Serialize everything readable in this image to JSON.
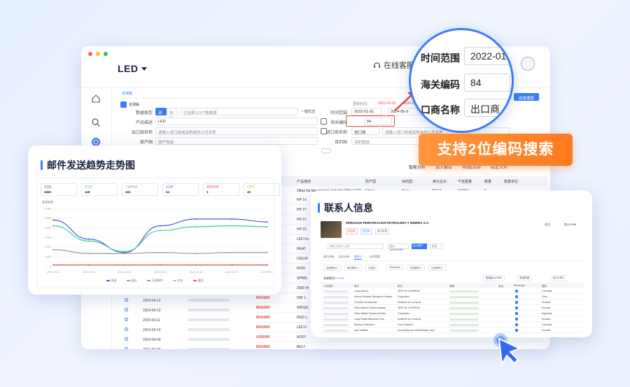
{
  "app": {
    "title": "LED",
    "online_service": "在线客服"
  },
  "window_dots": [
    "#ff5f57",
    "#febc2e",
    "#28c840"
  ],
  "breadcrumb": "全球版",
  "filter": {
    "tag": "全球版",
    "data_type_label": "数据类型",
    "import": "进口",
    "export": "出口",
    "dataset_value": "已选择123个数据源",
    "one_key": "一键优选",
    "product_label": "产品描述",
    "product_value": "LED",
    "exporter_label": "出口商名称",
    "exporter_placeholder": "请输入进口商或采购商的公司名称",
    "origin_label": "原产国",
    "origin_placeholder": "原产地选",
    "update_label": "更新时间：",
    "update_from": "2021-01-01",
    "update_to": "2024-05-09",
    "time_label": "时间范围",
    "time_from": "2022-01-01",
    "time_to": "2024-05-0",
    "hs_label": "海关编码",
    "hs_value": "84",
    "importer_label": "进口商名称",
    "importer_select": "进口商",
    "importer_placeholder": "请输入进口商或采购商的公司名称",
    "dest_label": "目的国",
    "dest_placeholder": "目的国选",
    "advanced_button": "高级搜索"
  },
  "toolbar": {
    "smart_analysis": "智能分析",
    "add_report": "加入报告",
    "export_excel": "导出Excel",
    "custom_columns": "自定义列"
  },
  "table": {
    "headers": [
      "产品描述",
      "原产国",
      "目的国",
      "美元总价",
      "千克重量",
      "数量",
      "数量单位"
    ],
    "first_row": {
      "desc": "Other for the propane industry Other LED",
      "origin": "China",
      "dest": "Peru",
      "price": "$2.67",
      "weight": "3,0064",
      "qty": "6"
    },
    "codes": [
      "4190000",
      "8541800",
      "8541800",
      "8541800",
      "8541800",
      "8541800",
      "4190000",
      "8541800",
      "8541800",
      "8541800",
      "8541800",
      "8541800",
      "8541800",
      "8541800",
      "4190000",
      "8541800",
      "8541800",
      "8541800",
      "8541800",
      "8541800",
      "8541800",
      "8541800",
      "8541800",
      "8541800"
    ],
    "descs": [
      "",
      "HP 14.",
      "HP 27.",
      "HP 21.",
      "HP 21.",
      "LED Fe.",
      "HEAT.",
      "CEILIP.",
      "PF09.",
      "SPWE.",
      "2000 W",
      "DW 1.",
      "WDGN.",
      "RGD L.",
      "LED F.",
      "ASSY.",
      "BELT.",
      "HP 20.",
      "Sight C.",
      "HP 2.",
      "PIXELS.",
      "",
      "",
      ""
    ],
    "bottom_rows": [
      {
        "date": "2024-04-12",
        "code": "8541800",
        "desc": "ASSY."
      },
      {
        "date": "2024-04-12",
        "code": "4190000",
        "desc": "BELT."
      },
      {
        "date": "2024-04-11",
        "code": "8471800",
        "desc": "HP 20."
      },
      {
        "date": "2024-04-10",
        "code": "8471800",
        "desc": "HP 20."
      },
      {
        "date": "2024-04-09",
        "code": "8541800",
        "desc": "Sight C"
      },
      {
        "date": "2024-04-09",
        "code": "8471800",
        "desc": "HP 2."
      },
      {
        "date": "2024-04-06",
        "code": "8471800",
        "desc": "PIXELS."
      }
    ]
  },
  "magnifier": {
    "time_label": "时间范围",
    "time_value": "2022-01-",
    "hs_label": "海关编码",
    "hs_value": "84",
    "exporter_label": "口商名称",
    "exporter_value": "出口商"
  },
  "bubble": "支持2位编码搜索",
  "email_card": {
    "title": "邮件发送趋势走势图",
    "stats": [
      {
        "label": "发送量",
        "value": "4650",
        "color": "#4b5fd6"
      },
      {
        "label": "送达率",
        "value": "448",
        "color": "#3ccf8e"
      },
      {
        "label": "已读邮件数",
        "value": "363",
        "color": "#999999"
      },
      {
        "label": "点击率",
        "value": "64",
        "color": "#4b5fd6"
      },
      {
        "label": "退回邮件数",
        "value": "3",
        "color": "#e05555"
      },
      {
        "label": "回复率",
        "value": "40",
        "color": "#f5b63d"
      }
    ],
    "chart_title": "发送走势",
    "legend": [
      "发送",
      "送达",
      "已读邮件",
      "点击",
      "退回"
    ],
    "legend_colors": [
      "#4b5fd6",
      "#3ccf8e",
      "#999999",
      "#f0a0c0",
      "#e05555"
    ]
  },
  "chart_data": {
    "type": "line",
    "title": "发送走势",
    "x": [
      "2023-02-25",
      "2023-03-24",
      "2023-05-28",
      "2023-05-11",
      "2023-06-18",
      "2023-07-29",
      "2023-08-13"
    ],
    "ylim": [
      0,
      6000
    ],
    "series": [
      {
        "name": "发送",
        "values": [
          4800,
          2800,
          1400,
          4200,
          4900,
          4900,
          4600
        ],
        "color": "#4b5fd6"
      },
      {
        "name": "送达",
        "values": [
          4200,
          2600,
          1500,
          3700,
          4100,
          4200,
          4100
        ],
        "color": "#3ccf8e"
      },
      {
        "name": "已读邮件",
        "values": [
          1700,
          1300,
          1300,
          1400,
          1300,
          1400,
          1400
        ],
        "color": "#999999"
      },
      {
        "name": "退回",
        "values": [
          100,
          100,
          100,
          100,
          100,
          100,
          100
        ],
        "color": "#e05555"
      }
    ]
  },
  "contact_card": {
    "title": "联系人信息",
    "company": "PERUVIAN PERFORACION PETROLERA Y MINERA S.A.",
    "buttons": {
      "follow": "关注",
      "create": "加入CRM"
    },
    "tags": [
      "供应商",
      "采购商",
      "出口记录"
    ],
    "search_placeholder": "请输入联系人名称",
    "add_button": "加入WHATSAPP",
    "import_button": "加入客户",
    "follow_button": "关注",
    "tabs": [
      "进口分析",
      "出口分析",
      "联系人",
      "公司信息"
    ],
    "subtabs": [
      "全部联系人",
      "邮件联系人",
      "已验证",
      "WhatsApp",
      "电话联系人",
      "社交联系人"
    ],
    "count_label": "有邮联系人",
    "count": "2040",
    "right_buttons": [
      "批量加入CRM",
      "导出所选",
      "加入CRM"
    ],
    "headers": [
      "公司名称",
      "姓名",
      "职位",
      "邮箱",
      "电话",
      "WhatsApp",
      "国家"
    ],
    "rows": [
      {
        "name": "Luisa Alarcon",
        "title": "JEFE DE COMPRAS",
        "country": "Colombia"
      },
      {
        "name": "Alberto Rolando Salvatierra Olmedo",
        "title": "Comprador",
        "country": "Chile"
      },
      {
        "name": "Christian Iovaszewski",
        "title": "Asistente de Compras",
        "country": "Ecuador"
      },
      {
        "name": "Pablo Alberto Rosario Almeda",
        "title": "JEFE DE COMPRAS",
        "country": "Ecuador"
      },
      {
        "name": "Pablo Alberto Rosario Almeda",
        "title": "Comprador",
        "country": "Argentina"
      },
      {
        "name": "Jorge Rafael Bañuelos Lima",
        "title": "Asistente de Compras",
        "country": "Ecuador"
      },
      {
        "name": "Sparky Christopher",
        "title": "Vice President",
        "country": "Colombia"
      },
      {
        "name": "grau wahilton",
        "title": "accounting and administration dept",
        "country": "Ecuador"
      }
    ]
  }
}
